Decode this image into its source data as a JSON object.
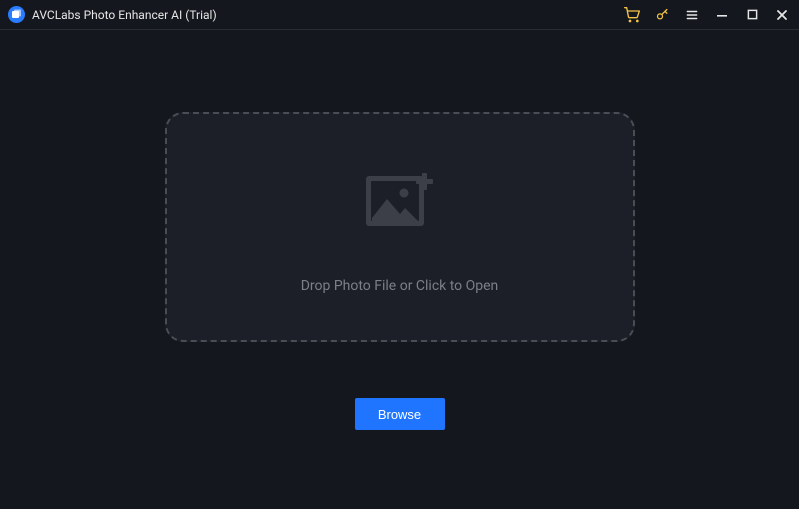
{
  "titlebar": {
    "app_title": "AVCLabs Photo Enhancer AI (Trial)"
  },
  "dropzone": {
    "prompt": "Drop Photo File or Click to Open"
  },
  "actions": {
    "browse_label": "Browse"
  },
  "colors": {
    "accent": "#1f75ff",
    "highlight": "#f5c544",
    "background": "#14171e",
    "panel": "#1c1f27"
  },
  "icons": {
    "logo": "app-logo",
    "cart": "cart-icon",
    "key": "key-icon",
    "menu": "menu-icon",
    "minimize": "minimize-icon",
    "maximize": "maximize-icon",
    "close": "close-icon",
    "picture_add": "picture-add-icon"
  }
}
